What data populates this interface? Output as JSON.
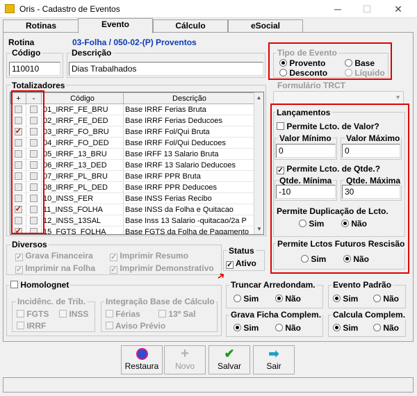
{
  "window": {
    "title": "Oris - Cadastro de Eventos",
    "minimize": "─",
    "maximize": "☐",
    "close": "✕"
  },
  "tabs": [
    "Rotinas",
    "Evento",
    "Cálculo",
    "eSocial"
  ],
  "rotina": {
    "label": "Rotina",
    "value": "03-Folha / 050-02-(P) Proventos"
  },
  "codigo": {
    "label": "Código",
    "value": "110010"
  },
  "descricao": {
    "label": "Descrição",
    "value": "Dias Trabalhados"
  },
  "tipo_evento": {
    "label": "Tipo de Evento",
    "options": [
      "Provento",
      "Base",
      "Desconto",
      "Líquido"
    ],
    "selected": "Provento"
  },
  "formulario": {
    "label": "Formulário TRCT",
    "value": ""
  },
  "totalizadores": {
    "label": "Totalizadores",
    "headers": [
      "+",
      "-",
      "Código",
      "Descrição"
    ],
    "rows": [
      {
        "plus": false,
        "minus": false,
        "code": "01_IRRF_FE_BRU",
        "desc": "Base IRRF Ferias Bruta"
      },
      {
        "plus": false,
        "minus": false,
        "code": "02_IRRF_FE_DED",
        "desc": "Base IRRF Ferias Deducoes"
      },
      {
        "plus": true,
        "minus": false,
        "code": "03_IRRF_FO_BRU",
        "desc": "Base IRRF Fol/Qui Bruta"
      },
      {
        "plus": false,
        "minus": false,
        "code": "04_IRRF_FO_DED",
        "desc": "Base IRRF Fol/Qui Deducoes"
      },
      {
        "plus": false,
        "minus": false,
        "code": "05_IRRF_13_BRU",
        "desc": "Base IRFF 13 Salario Bruta"
      },
      {
        "plus": false,
        "minus": false,
        "code": "06_IRRF_13_DED",
        "desc": "Base IRRF 13 Salario Deducoes"
      },
      {
        "plus": false,
        "minus": false,
        "code": "07_IRRF_PL_BRU",
        "desc": "Base IRRF PPR Bruta"
      },
      {
        "plus": false,
        "minus": false,
        "code": "08_IRRF_PL_DED",
        "desc": "Base IRRF PPR Deducoes"
      },
      {
        "plus": false,
        "minus": false,
        "code": "10_INSS_FER",
        "desc": "Base INSS Ferias Recibo"
      },
      {
        "plus": true,
        "minus": false,
        "code": "11_INSS_FOLHA",
        "desc": "Base INSS da Folha e Quitacao"
      },
      {
        "plus": false,
        "minus": false,
        "code": "12_INSS_13SAL",
        "desc": "Base Inss 13 Salario -quitacao/2a P"
      },
      {
        "plus": true,
        "minus": false,
        "code": "15_FGTS_FOLHA",
        "desc": "Base FGTS da Folha de Pagamento"
      }
    ]
  },
  "lancamentos": {
    "label": "Lançamentos",
    "permite_valor": "Permite Lcto. de Valor?",
    "permite_valor_checked": false,
    "valor_minimo": {
      "label": "Valor Mínimo",
      "value": "0"
    },
    "valor_maximo": {
      "label": "Valor Máximo",
      "value": "0"
    },
    "permite_qtde": "Permite Lcto. de Qtde.?",
    "permite_qtde_checked": true,
    "qtde_minima": {
      "label": "Qtde. Mínima",
      "value": "-10"
    },
    "qtde_maxima": {
      "label": "Qtde. Máxima",
      "value": "30"
    },
    "duplicacao": {
      "label": "Permite Duplicação de Lcto.",
      "sim": "Sim",
      "nao": "Não",
      "selected": "Não"
    }
  },
  "futuros": {
    "label": "Permite Lctos Futuros Rescisão",
    "sim": "Sim",
    "nao": "Não",
    "selected": "Não"
  },
  "diversos": {
    "label": "Diversos",
    "items": [
      "Grava Financeira",
      "Imprimir Resumo",
      "Imprimir na Folha",
      "Imprimir Demonstrativo"
    ]
  },
  "status": {
    "label": "Status",
    "ativo": "Ativo",
    "checked": true
  },
  "homolognet": {
    "label": "Homolognet",
    "incidencia": "Incidênc. de Trib.",
    "fgts": "FGTS",
    "inss": "INSS",
    "irrf": "IRRF",
    "integracao": "Integração Base de Cálculo",
    "ferias": "Férias",
    "sal13": "13º Sal",
    "aviso": "Aviso Prévio"
  },
  "truncar": {
    "label": "Truncar Arredondam.",
    "sim": "Sim",
    "nao": "Não",
    "selected": "Não"
  },
  "evento_padrao": {
    "label": "Evento Padrão",
    "sim": "Sim",
    "nao": "Não",
    "selected": "Sim"
  },
  "grava_ficha": {
    "label": "Grava Ficha Complem.",
    "sim": "Sim",
    "nao": "Não",
    "selected": "Sim"
  },
  "calcula_complem": {
    "label": "Calcula Complem.",
    "sim": "Sim",
    "nao": "Não",
    "selected": "Sim"
  },
  "buttons": {
    "restaura": "Restaura",
    "novo": "Novo",
    "salvar": "Salvar",
    "sair": "Sair"
  },
  "colors": {
    "highlight": "#e00000",
    "rotina_text": "#0a3cb4"
  }
}
